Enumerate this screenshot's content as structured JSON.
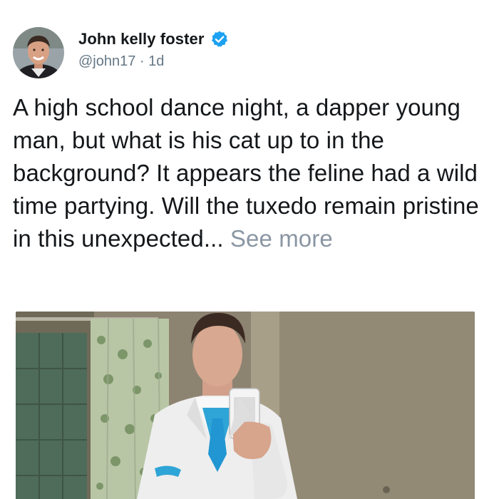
{
  "author": {
    "display_name": "John kelly foster",
    "handle": "@john17",
    "separator": " · ",
    "time": "1d",
    "verified": true,
    "avatar_icon": "person-avatar",
    "verified_icon": "verified-badge-icon"
  },
  "tweet": {
    "text": "A high school dance night, a dapper young man, but what is his cat up to in the background? It appears the feline had a wild time partying. Will the tuxedo remain pristine in this unexpected...",
    "see_more": "See more"
  },
  "media": {
    "type": "photo"
  },
  "colors": {
    "text": "#14171a",
    "secondary": "#657786",
    "see_more": "#8a96a3",
    "verified_blue": "#1da1f2"
  }
}
